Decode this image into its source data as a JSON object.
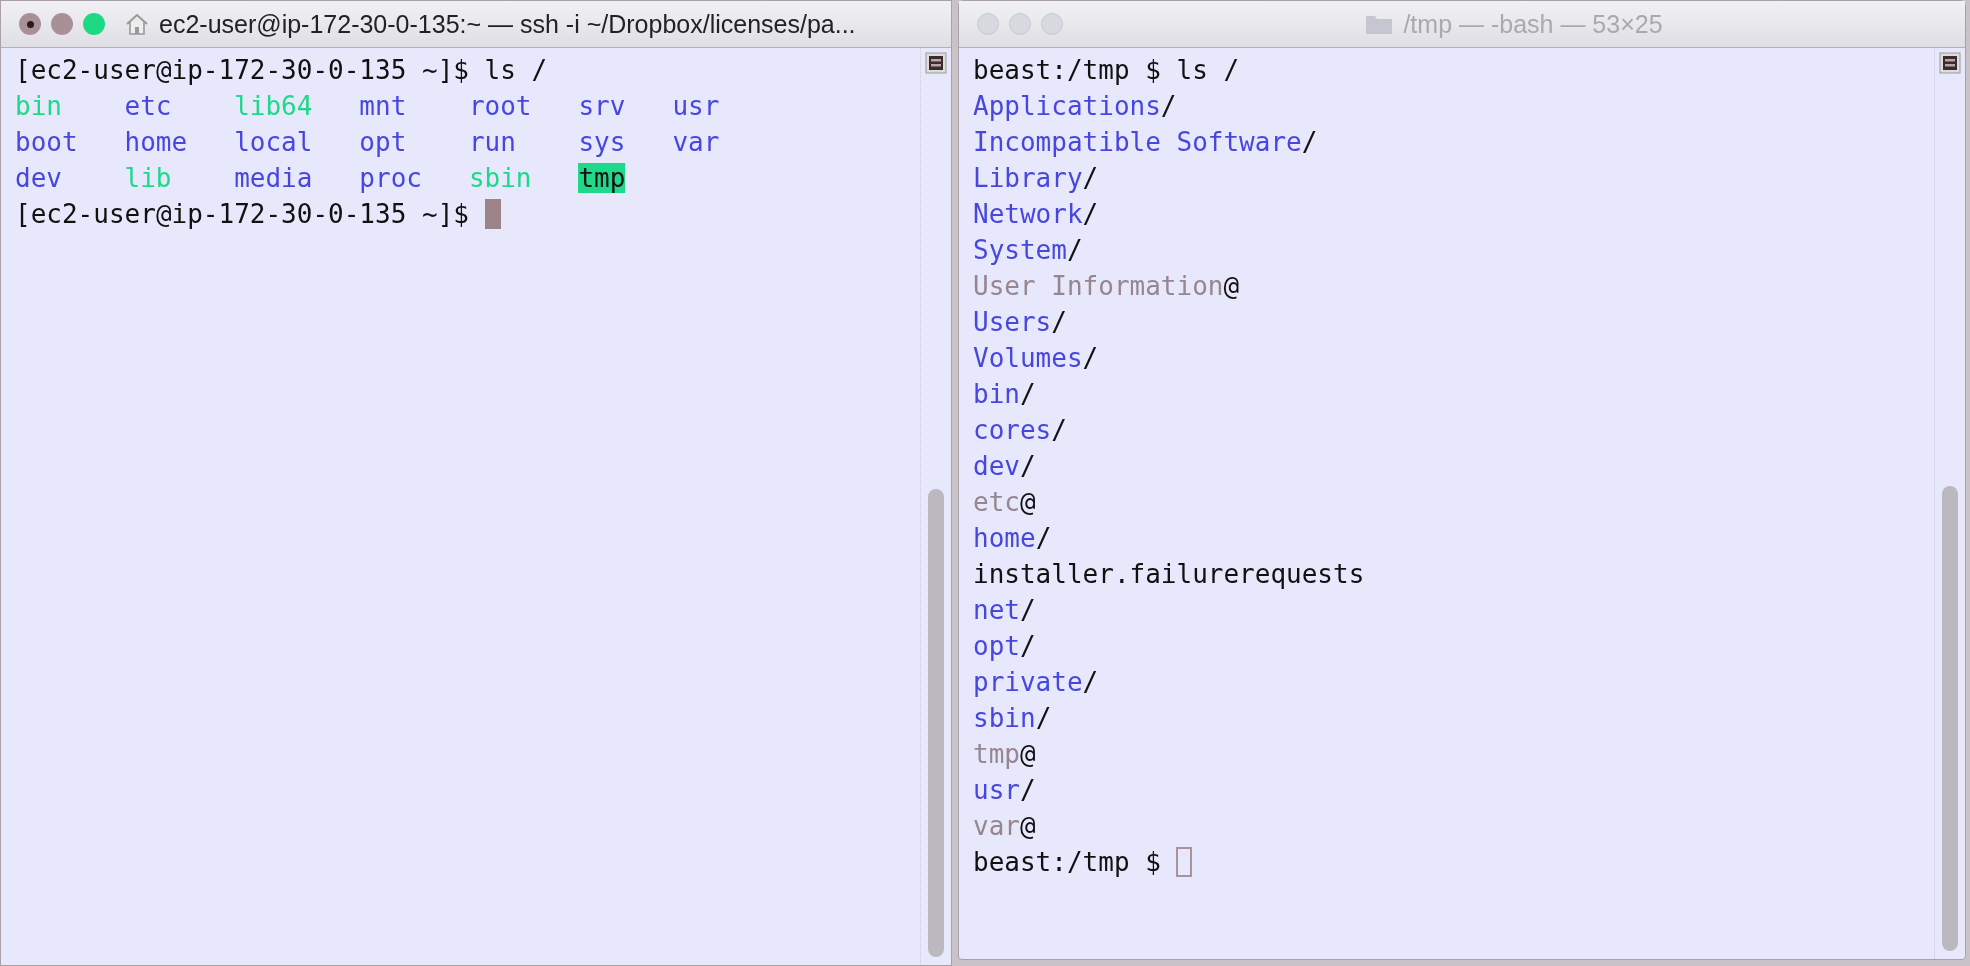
{
  "windows": [
    {
      "title": "ec2-user@ip-172-30-0-135:~ — ssh -i ~/Dropbox/licenses/pa...",
      "active": true,
      "icon": {
        "kind": "house"
      },
      "prompt": "[ec2-user@ip-172-30-0-135 ~]$",
      "command": "ls /",
      "final_prompt": "[ec2-user@ip-172-30-0-135 ~]$",
      "kind": "columns",
      "entries": [
        [
          {
            "name": "bin",
            "kind": "link"
          },
          {
            "name": "etc",
            "kind": "dir"
          },
          {
            "name": "lib64",
            "kind": "link"
          },
          {
            "name": "mnt",
            "kind": "dir"
          },
          {
            "name": "root",
            "kind": "dir"
          },
          {
            "name": "srv",
            "kind": "dir"
          },
          {
            "name": "usr",
            "kind": "dir"
          }
        ],
        [
          {
            "name": "boot",
            "kind": "dir"
          },
          {
            "name": "home",
            "kind": "dir"
          },
          {
            "name": "local",
            "kind": "dir"
          },
          {
            "name": "opt",
            "kind": "dir"
          },
          {
            "name": "run",
            "kind": "dir"
          },
          {
            "name": "sys",
            "kind": "dir"
          },
          {
            "name": "var",
            "kind": "dir"
          }
        ],
        [
          {
            "name": "dev",
            "kind": "dir"
          },
          {
            "name": "lib",
            "kind": "link"
          },
          {
            "name": "media",
            "kind": "dir"
          },
          {
            "name": "proc",
            "kind": "dir"
          },
          {
            "name": "sbin",
            "kind": "link"
          },
          {
            "name": "tmp",
            "kind": "sticky"
          }
        ]
      ]
    },
    {
      "title": "/tmp — -bash — 53×25",
      "active": false,
      "icon": {
        "kind": "folder"
      },
      "prompt": "beast:/tmp $",
      "command": "ls /",
      "final_prompt": "beast:/tmp $",
      "kind": "lines",
      "entries": [
        [
          {
            "name": "Applications",
            "suffix": "/",
            "kind": "dir"
          }
        ],
        [
          {
            "name": "Incompatible Software",
            "suffix": "/",
            "kind": "dir"
          }
        ],
        [
          {
            "name": "Library",
            "suffix": "/",
            "kind": "dir"
          }
        ],
        [
          {
            "name": "Network",
            "suffix": "/",
            "kind": "dir"
          }
        ],
        [
          {
            "name": "System",
            "suffix": "/",
            "kind": "dir"
          }
        ],
        [
          {
            "name": "User Information",
            "suffix": "@",
            "kind": "link"
          }
        ],
        [
          {
            "name": "Users",
            "suffix": "/",
            "kind": "dir"
          }
        ],
        [
          {
            "name": "Volumes",
            "suffix": "/",
            "kind": "dir"
          }
        ],
        [
          {
            "name": "bin",
            "suffix": "/",
            "kind": "dir"
          }
        ],
        [
          {
            "name": "cores",
            "suffix": "/",
            "kind": "dir"
          }
        ],
        [
          {
            "name": "dev",
            "suffix": "/",
            "kind": "dir"
          }
        ],
        [
          {
            "name": "etc",
            "suffix": "@",
            "kind": "link"
          }
        ],
        [
          {
            "name": "home",
            "suffix": "/",
            "kind": "dir"
          }
        ],
        [
          {
            "name": "installer.failurerequests",
            "kind": "file"
          }
        ],
        [
          {
            "name": "net",
            "suffix": "/",
            "kind": "dir"
          }
        ],
        [
          {
            "name": "opt",
            "suffix": "/",
            "kind": "dir"
          }
        ],
        [
          {
            "name": "private",
            "suffix": "/",
            "kind": "dir"
          }
        ],
        [
          {
            "name": "sbin",
            "suffix": "/",
            "kind": "dir"
          }
        ],
        [
          {
            "name": "tmp",
            "suffix": "@",
            "kind": "link"
          }
        ],
        [
          {
            "name": "usr",
            "suffix": "/",
            "kind": "dir"
          }
        ],
        [
          {
            "name": "var",
            "suffix": "@",
            "kind": "link"
          }
        ]
      ]
    }
  ]
}
